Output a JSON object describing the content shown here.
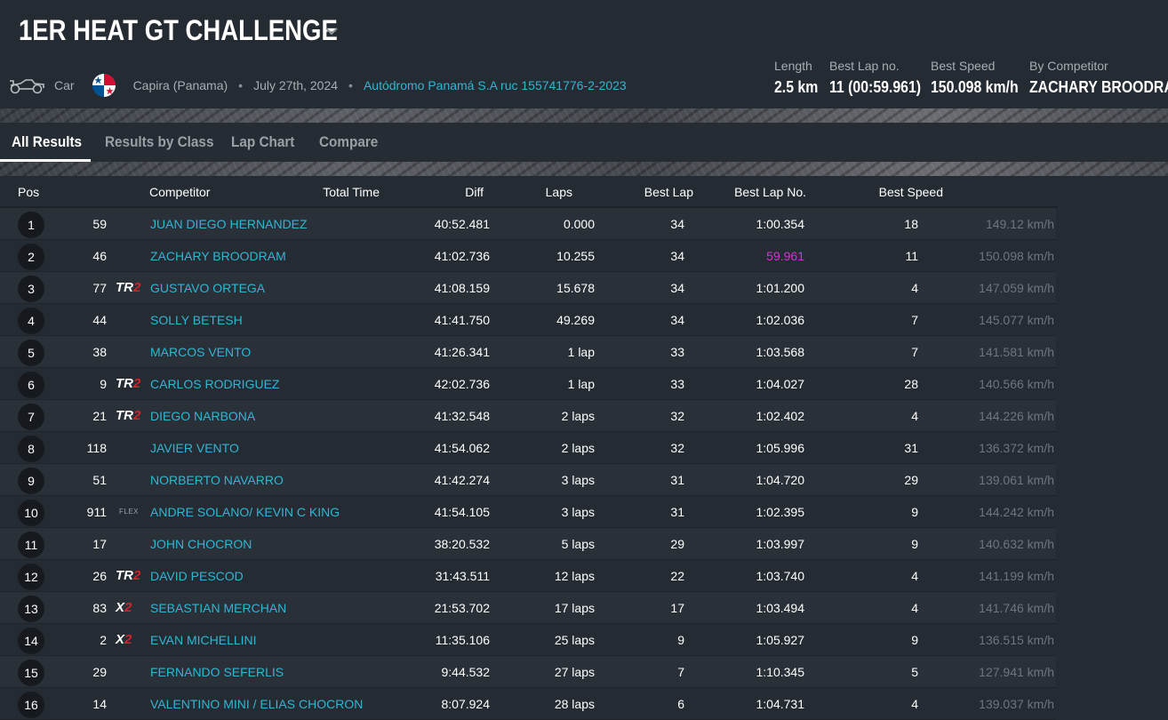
{
  "event": {
    "title": "1ER HEAT GT CHALLENGE",
    "type": "Car",
    "location": "Capira (Panama)",
    "date": "July 27th, 2024",
    "organizer": "Autódromo Panamá S.A ruc 155741776-2-2023"
  },
  "stats": {
    "length_label": "Length",
    "length_value": "2.5 km",
    "best_lap_label": "Best Lap no.",
    "best_lap_value": "11 (00:59.961)",
    "best_speed_label": "Best Speed",
    "best_speed_value": "150.098 km/h",
    "by_label": "By Competitor",
    "by_value": "ZACHARY BROODRAM"
  },
  "tabs": [
    "All Results",
    "Results by Class",
    "Lap Chart",
    "Compare"
  ],
  "columns": {
    "pos": "Pos",
    "competitor": "Competitor",
    "total_time": "Total Time",
    "diff": "Diff",
    "laps": "Laps",
    "best_lap": "Best Lap",
    "best_lap_no": "Best Lap No.",
    "best_speed": "Best Speed"
  },
  "rows": [
    {
      "pos": "1",
      "num": "59",
      "cls": "",
      "name": "JUAN DIEGO HERNANDEZ",
      "total": "40:52.481",
      "diff": "0.000",
      "laps": "34",
      "best": "1:00.354",
      "best_no": "18",
      "speed": "149.12 km/h"
    },
    {
      "pos": "2",
      "num": "46",
      "cls": "",
      "name": "ZACHARY BROODRAM",
      "total": "41:02.736",
      "diff": "10.255",
      "laps": "34",
      "best": "59.961",
      "best_no": "11",
      "speed": "150.098 km/h"
    },
    {
      "pos": "3",
      "num": "77",
      "cls": "TR2",
      "name": "GUSTAVO ORTEGA",
      "total": "41:08.159",
      "diff": "15.678",
      "laps": "34",
      "best": "1:01.200",
      "best_no": "4",
      "speed": "147.059 km/h"
    },
    {
      "pos": "4",
      "num": "44",
      "cls": "",
      "name": "SOLLY BETESH",
      "total": "41:41.750",
      "diff": "49.269",
      "laps": "34",
      "best": "1:02.036",
      "best_no": "7",
      "speed": "145.077 km/h"
    },
    {
      "pos": "5",
      "num": "38",
      "cls": "",
      "name": "MARCOS VENTO",
      "total": "41:26.341",
      "diff": "1 lap",
      "laps": "33",
      "best": "1:03.568",
      "best_no": "7",
      "speed": "141.581 km/h"
    },
    {
      "pos": "6",
      "num": "9",
      "cls": "TR2",
      "name": "CARLOS RODRIGUEZ",
      "total": "42:02.736",
      "diff": "1 lap",
      "laps": "33",
      "best": "1:04.027",
      "best_no": "28",
      "speed": "140.566 km/h"
    },
    {
      "pos": "7",
      "num": "21",
      "cls": "TR2",
      "name": "DIEGO NARBONA",
      "total": "41:32.548",
      "diff": "2 laps",
      "laps": "32",
      "best": "1:02.402",
      "best_no": "4",
      "speed": "144.226 km/h"
    },
    {
      "pos": "8",
      "num": "118",
      "cls": "",
      "name": "JAVIER VENTO",
      "total": "41:54.062",
      "diff": "2 laps",
      "laps": "32",
      "best": "1:05.996",
      "best_no": "31",
      "speed": "136.372 km/h"
    },
    {
      "pos": "9",
      "num": "51",
      "cls": "",
      "name": "NORBERTO NAVARRO",
      "total": "41:42.274",
      "diff": "3 laps",
      "laps": "31",
      "best": "1:04.720",
      "best_no": "29",
      "speed": "139.061 km/h"
    },
    {
      "pos": "10",
      "num": "911",
      "cls": "FLEX",
      "name": "ANDRE SOLANO/ KEVIN C KING",
      "total": "41:54.105",
      "diff": "3 laps",
      "laps": "31",
      "best": "1:02.395",
      "best_no": "9",
      "speed": "144.242 km/h"
    },
    {
      "pos": "11",
      "num": "17",
      "cls": "",
      "name": "JOHN CHOCRON",
      "total": "38:20.532",
      "diff": "5 laps",
      "laps": "29",
      "best": "1:03.997",
      "best_no": "9",
      "speed": "140.632 km/h"
    },
    {
      "pos": "12",
      "num": "26",
      "cls": "TR2",
      "name": "DAVID PESCOD",
      "total": "31:43.511",
      "diff": "12 laps",
      "laps": "22",
      "best": "1:03.740",
      "best_no": "4",
      "speed": "141.199 km/h"
    },
    {
      "pos": "13",
      "num": "83",
      "cls": "X2",
      "name": "SEBASTIAN MERCHAN",
      "total": "21:53.702",
      "diff": "17 laps",
      "laps": "17",
      "best": "1:03.494",
      "best_no": "4",
      "speed": "141.746 km/h"
    },
    {
      "pos": "14",
      "num": "2",
      "cls": "X2",
      "name": "EVAN MICHELLINI",
      "total": "11:35.106",
      "diff": "25 laps",
      "laps": "9",
      "best": "1:05.927",
      "best_no": "9",
      "speed": "136.515 km/h"
    },
    {
      "pos": "15",
      "num": "29",
      "cls": "",
      "name": "FERNANDO SEFERLIS",
      "total": "9:44.532",
      "diff": "27 laps",
      "laps": "7",
      "best": "1:10.345",
      "best_no": "5",
      "speed": "127.941 km/h"
    },
    {
      "pos": "16",
      "num": "14",
      "cls": "",
      "name": "VALENTINO MINI / ELIAS CHOCRON",
      "total": "8:07.924",
      "diff": "28 laps",
      "laps": "6",
      "best": "1:04.731",
      "best_no": "4",
      "speed": "139.037 km/h"
    }
  ],
  "colors": {
    "accent": "#2fb6d3",
    "best_lap": "#d633d6",
    "class_red": "#d9212a",
    "background": "#252b33"
  }
}
